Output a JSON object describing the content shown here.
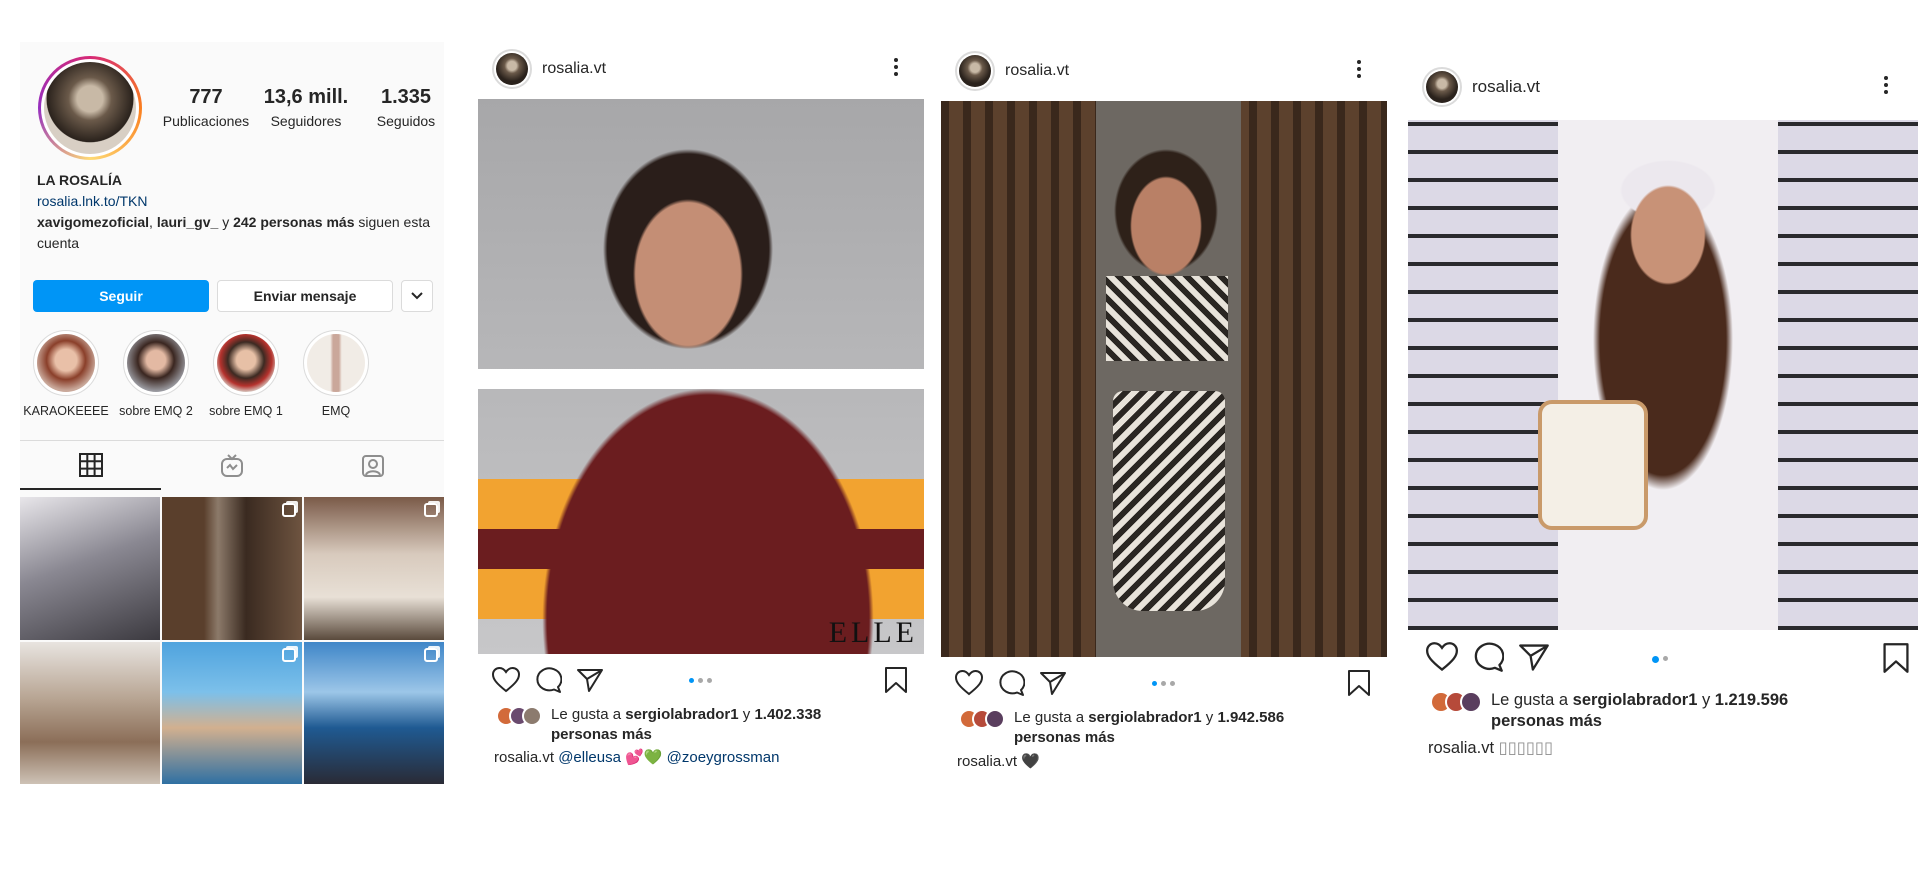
{
  "profile": {
    "stats": [
      {
        "value": "777",
        "label": "Publicaciones"
      },
      {
        "value": "13,6 mill.",
        "label": "Seguidores"
      },
      {
        "value": "1.335",
        "label": "Seguidos"
      }
    ],
    "display_name": "LA ROSALÍA",
    "link": "rosalia.lnk.to/TKN",
    "followed_by": {
      "user1": "xavigomezoficial",
      "sep": ", ",
      "user2": "lauri_gv_",
      "mid": " y ",
      "others": "242 personas más",
      "tail": " siguen esta cuenta"
    },
    "follow_label": "Seguir",
    "message_label": "Enviar mensaje",
    "highlights": [
      {
        "label": "KARAOKEEEE"
      },
      {
        "label": "sobre EMQ 2"
      },
      {
        "label": "sobre EMQ 1"
      },
      {
        "label": "EMQ"
      }
    ]
  },
  "posts": [
    {
      "username": "rosalia.vt",
      "liked_by_prefix": "Le gusta a ",
      "liked_by_user": "sergiolabrador1",
      "liked_by_mid": " y ",
      "liked_by_count": "1.402.338",
      "liked_by_suffix": "personas más",
      "caption_user": "rosalia.vt",
      "caption_text": " @elleusa 💕💚 @zoeygrossman",
      "watermark": "ELLE"
    },
    {
      "username": "rosalia.vt",
      "liked_by_prefix": "Le gusta a ",
      "liked_by_user": "sergiolabrador1",
      "liked_by_mid": " y ",
      "liked_by_count": "1.942.586",
      "liked_by_suffix": "personas más",
      "caption_user": "rosalia.vt",
      "caption_text": " 🖤"
    },
    {
      "username": "rosalia.vt",
      "liked_by_prefix": "Le gusta a ",
      "liked_by_user": "sergiolabrador1",
      "liked_by_mid": " y ",
      "liked_by_count": "1.219.596",
      "liked_by_suffix": "personas más",
      "caption_user": "rosalia.vt",
      "caption_text": " ▯▯▯▯▯▯"
    }
  ],
  "icons": [
    "grid-icon",
    "igtv-icon",
    "tagged-icon",
    "heart-icon",
    "comment-icon",
    "share-icon",
    "bookmark-icon",
    "more-icon",
    "chevron-down-icon"
  ],
  "colors": {
    "accent": "#0095f6",
    "link": "#00376b",
    "text": "#262626",
    "border": "#dbdbdb"
  }
}
